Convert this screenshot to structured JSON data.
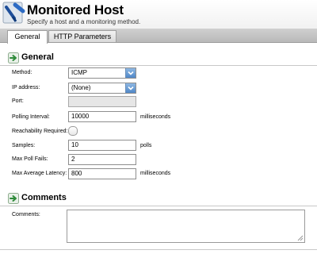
{
  "header": {
    "title": "Monitored Host",
    "subtitle": "Specify a host and a monitoring method."
  },
  "tabs": [
    {
      "label": "General",
      "active": true
    },
    {
      "label": "HTTP Parameters",
      "active": false
    }
  ],
  "sections": {
    "general": "General",
    "comments": "Comments"
  },
  "form": {
    "method": {
      "label": "Method:",
      "value": "ICMP"
    },
    "ip_address": {
      "label": "IP address:",
      "value": "(None)"
    },
    "port": {
      "label": "Port:",
      "value": ""
    },
    "polling_interval": {
      "label": "Polling Interval:",
      "value": "10000",
      "unit": "milliseconds"
    },
    "reachability_required": {
      "label": "Reachability Required:",
      "checked": false
    },
    "samples": {
      "label": "Samples:",
      "value": "10",
      "unit": "polls"
    },
    "max_poll_fails": {
      "label": "Max Poll Fails:",
      "value": "2"
    },
    "max_average_latency": {
      "label": "Max Average Latency:",
      "value": "800",
      "unit": "milliseconds"
    },
    "comments": {
      "label": "Comments:",
      "value": ""
    }
  },
  "colors": {
    "select_button": "#4f87c7",
    "tab_bar": "#c4c4c4",
    "section_icon": "#2e8b3a"
  },
  "icons": {
    "header": "wand-icon",
    "section": "green-arrow-icon",
    "dropdown": "chevron-down-icon"
  }
}
